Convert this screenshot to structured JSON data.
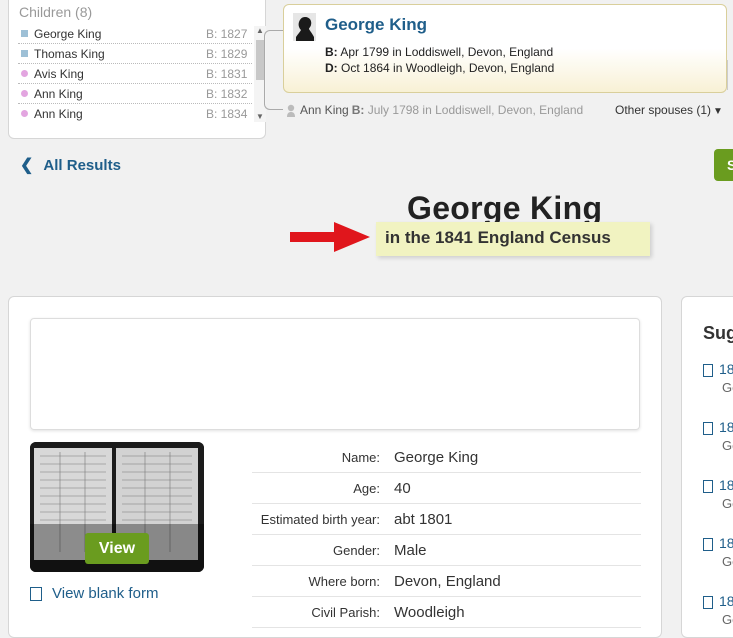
{
  "children_panel": {
    "title": "Children (8)",
    "children": [
      {
        "name": "George King",
        "birth": "B: 1827",
        "gender": "m"
      },
      {
        "name": "Thomas King",
        "birth": "B: 1829",
        "gender": "m"
      },
      {
        "name": "Avis King",
        "birth": "B: 1831",
        "gender": "f"
      },
      {
        "name": "Ann King",
        "birth": "B: 1832",
        "gender": "f"
      },
      {
        "name": "Ann King",
        "birth": "B: 1834",
        "gender": "f"
      }
    ]
  },
  "person": {
    "name": "George King",
    "birth_label": "B:",
    "birth": "Apr 1799 in Loddiswell, Devon, England",
    "death_label": "D:",
    "death": "Oct 1864 in Woodleigh, Devon, England"
  },
  "spouse": {
    "name": "Ann King",
    "birth_label": "B:",
    "birth": "July 1798 in Loddiswell, Devon, England",
    "other_spouses": "Other spouses (1)"
  },
  "nav": {
    "back_label": "All Results",
    "green_button_label": "S"
  },
  "record": {
    "title": "George King",
    "subtitle": "in the 1841 England Census"
  },
  "image_panel": {
    "view_label": "View",
    "blank_form_label": "View blank form"
  },
  "details": [
    {
      "label": "Name:",
      "value": "George King"
    },
    {
      "label": "Age:",
      "value": "40"
    },
    {
      "label": "Estimated birth year:",
      "value": "abt 1801"
    },
    {
      "label": "Gender:",
      "value": "Male"
    },
    {
      "label": "Where born:",
      "value": "Devon, England"
    },
    {
      "label": "Civil Parish:",
      "value": "Woodleigh"
    }
  ],
  "suggestions": {
    "title": "Sug",
    "items": [
      {
        "title": "18",
        "sub": "Ge"
      },
      {
        "title": "18",
        "sub": "Ge"
      },
      {
        "title": "18",
        "sub": "Ge"
      },
      {
        "title": "18",
        "sub": "Ge"
      },
      {
        "title": "18",
        "sub": "Ge"
      }
    ]
  },
  "colors": {
    "link": "#1f5e8a",
    "green": "#6a9c1f",
    "highlight": "#f1f3c1",
    "arrow": "#e0161c"
  }
}
